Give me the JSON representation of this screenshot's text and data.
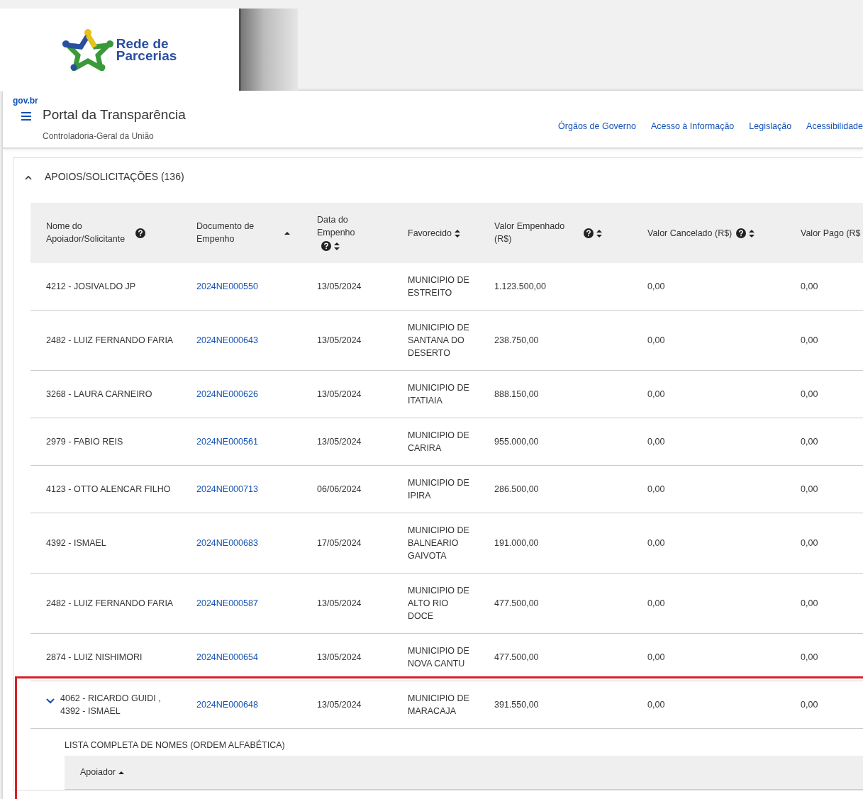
{
  "banner": {
    "logo_text": [
      "Rede de",
      "Parcerias"
    ]
  },
  "header": {
    "brand": "gov.br",
    "title": "Portal da Transparência",
    "subtitle": "Controladoria-Geral da União",
    "links": [
      "Órgãos de Governo",
      "Acesso à Informação",
      "Legislação",
      "Acessibilidade"
    ]
  },
  "section": {
    "title": "APOIOS/SOLICITAÇÕES (136)",
    "expanded": true
  },
  "table": {
    "columns": [
      {
        "label": "Nome do Apoiador/Solicitante",
        "help": true,
        "sortable": false
      },
      {
        "label": "Documento de Empenho",
        "help": false,
        "sortable": true,
        "sorted": true
      },
      {
        "label": "Data do Empenho",
        "help": true,
        "sortable": true,
        "sorted": false
      },
      {
        "label": "Favorecido",
        "help": false,
        "sortable": true,
        "sorted": false
      },
      {
        "label": "Valor Empenhado (R$)",
        "help": true,
        "sortable": true,
        "sorted": false
      },
      {
        "label": "Valor Cancelado (R$)",
        "help": true,
        "sortable": true,
        "sorted": false
      },
      {
        "label": "Valor Pago (R$",
        "help": false,
        "sortable": false
      }
    ],
    "rows": [
      {
        "cells": [
          "4212 - JOSIVALDO JP",
          "2024NE000550",
          "13/05/2024",
          "MUNICIPIO DE ESTREITO",
          "1.123.500,00",
          "0,00",
          "0,00"
        ],
        "expanded": false,
        "highlighted": false
      },
      {
        "cells": [
          "2482 - LUIZ FERNANDO FARIA",
          "2024NE000643",
          "13/05/2024",
          "MUNICIPIO DE SANTANA DO DESERTO",
          "238.750,00",
          "0,00",
          "0,00"
        ],
        "expanded": false,
        "highlighted": false
      },
      {
        "cells": [
          "3268 - LAURA CARNEIRO",
          "2024NE000626",
          "13/05/2024",
          "MUNICIPIO DE ITATIAIA",
          "888.150,00",
          "0,00",
          "0,00"
        ],
        "expanded": false,
        "highlighted": false
      },
      {
        "cells": [
          "2979 - FABIO REIS",
          "2024NE000561",
          "13/05/2024",
          "MUNICIPIO DE CARIRA",
          "955.000,00",
          "0,00",
          "0,00"
        ],
        "expanded": false,
        "highlighted": false
      },
      {
        "cells": [
          "4123 - OTTO ALENCAR FILHO",
          "2024NE000713",
          "06/06/2024",
          "MUNICIPIO DE IPIRA",
          "286.500,00",
          "0,00",
          "0,00"
        ],
        "expanded": false,
        "highlighted": false
      },
      {
        "cells": [
          "4392 - ISMAEL",
          "2024NE000683",
          "17/05/2024",
          "MUNICIPIO DE BALNEARIO GAIVOTA",
          "191.000,00",
          "0,00",
          "0,00"
        ],
        "expanded": false,
        "highlighted": false
      },
      {
        "cells": [
          "2482 - LUIZ FERNANDO FARIA",
          "2024NE000587",
          "13/05/2024",
          "MUNICIPIO DE ALTO RIO DOCE",
          "477.500,00",
          "0,00",
          "0,00"
        ],
        "expanded": false,
        "highlighted": false
      },
      {
        "cells": [
          "2874 - LUIZ NISHIMORI",
          "2024NE000654",
          "13/05/2024",
          "MUNICIPIO DE NOVA CANTU",
          "477.500,00",
          "0,00",
          "0,00"
        ],
        "expanded": false,
        "highlighted": false
      },
      {
        "cells": [
          "4062 - RICARDO GUIDI , 4392 - ISMAEL",
          "2024NE000648",
          "13/05/2024",
          "MUNICIPIO DE MARACAJA",
          "391.550,00",
          "0,00",
          "0,00"
        ],
        "expanded": true,
        "highlighted": true,
        "detail": {
          "title": "LISTA COMPLETA DE NOMES (ORDEM ALFABÉTICA)",
          "column": {
            "label": "Apoiador",
            "sortable": true,
            "sorted": true
          }
        }
      }
    ]
  }
}
